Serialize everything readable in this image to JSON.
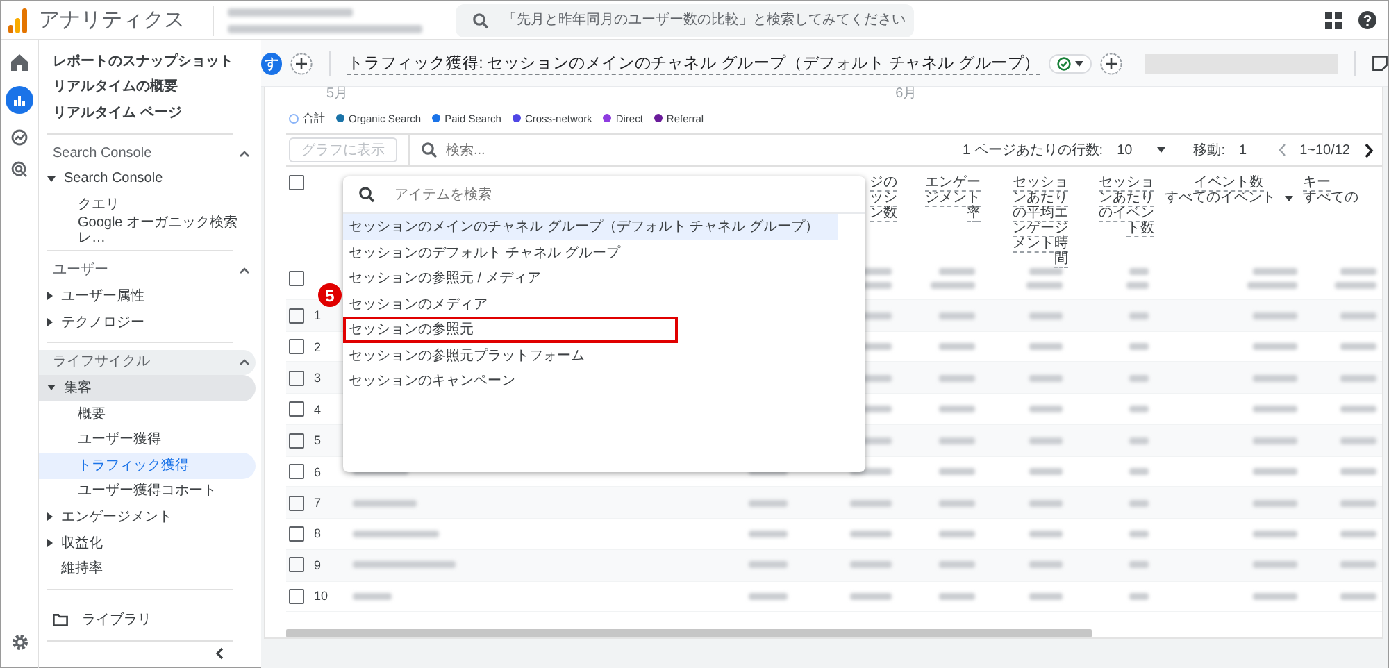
{
  "app": {
    "title": "アナリティクス"
  },
  "search": {
    "placeholder": "「先月と昨年同月のユーザー数の比較」と検索してみてください"
  },
  "sidebar": {
    "top_items": [
      {
        "label": "レポートのスナップショット",
        "selected": false
      },
      {
        "label": "リアルタイムの概要",
        "selected": false
      },
      {
        "label": "リアルタイム ページ",
        "selected": false
      }
    ],
    "sections": [
      {
        "title": "Search Console",
        "expanded": true,
        "items": [
          {
            "label": "Search Console",
            "expanded": true,
            "children": [
              {
                "label": "クエリ",
                "selected": false
              },
              {
                "label": "Google オーガニック検索レ…",
                "selected": false
              }
            ]
          }
        ]
      },
      {
        "title": "ユーザー",
        "expanded": true,
        "items": [
          {
            "label": "ユーザー属性",
            "expanded": false
          },
          {
            "label": "テクノロジー",
            "expanded": false
          }
        ]
      },
      {
        "title": "ライフサイクル",
        "expanded": true,
        "items": [
          {
            "label": "集客",
            "expanded": true,
            "children": [
              {
                "label": "概要",
                "selected": false
              },
              {
                "label": "ユーザー獲得",
                "selected": false
              },
              {
                "label": "トラフィック獲得",
                "selected": true
              },
              {
                "label": "ユーザー獲得コホート",
                "selected": false
              }
            ]
          },
          {
            "label": "エンゲージメント",
            "expanded": false
          },
          {
            "label": "収益化",
            "expanded": false
          },
          {
            "label": "維持率",
            "selected": false
          }
        ]
      }
    ],
    "library": {
      "label": "ライブラリ"
    }
  },
  "report": {
    "avatar": "す",
    "title": "トラフィック獲得: セッションのメインのチャネル グループ（デフォルト チャネル グループ）"
  },
  "chart": {
    "axis_labels": [
      "5月",
      "6月"
    ],
    "legend": [
      {
        "label": "合計",
        "color": "#8ab4f8",
        "kind": "ring"
      },
      {
        "label": "Organic Search",
        "color": "#1a73a8",
        "kind": "dot"
      },
      {
        "label": "Paid Search",
        "color": "#1a73e8",
        "kind": "dot"
      },
      {
        "label": "Cross-network",
        "color": "#4f46e5",
        "kind": "dot"
      },
      {
        "label": "Direct",
        "color": "#8e3ce0",
        "kind": "dot"
      },
      {
        "label": "Referral",
        "color": "#6a1b9a",
        "kind": "dot"
      }
    ]
  },
  "toolbar": {
    "chart_button": "グラフに表示",
    "search_placeholder": "検索...",
    "rows_label": "1 ページあたりの行数:",
    "rows_value": "10",
    "goto_label": "移動:",
    "goto_value": "1",
    "range": "1~10/12"
  },
  "table": {
    "columns": [
      {
        "label": "ジのッシン数"
      },
      {
        "label": "エンゲージメント率"
      },
      {
        "label": "セッションあたりの平均エンゲージメント時間"
      },
      {
        "label": "セッションあたりのイベント数"
      },
      {
        "label": "イベント数",
        "filter": "すべてのイベント"
      },
      {
        "label": "キー",
        "filter": "すべての"
      }
    ],
    "select_all_checked": false,
    "total_checked": false,
    "rows": [
      {
        "index": "1",
        "checked": false
      },
      {
        "index": "2",
        "checked": false
      },
      {
        "index": "3",
        "checked": false
      },
      {
        "index": "4",
        "checked": false
      },
      {
        "index": "5",
        "checked": false
      },
      {
        "index": "6",
        "checked": false
      },
      {
        "index": "7",
        "checked": false
      },
      {
        "index": "8",
        "checked": false
      },
      {
        "index": "9",
        "checked": false
      },
      {
        "index": "10",
        "checked": false
      }
    ]
  },
  "dropdown": {
    "placeholder": "アイテムを検索",
    "items": [
      {
        "label": "セッションのメインのチャネル グループ（デフォルト チャネル グループ）",
        "selected": true
      },
      {
        "label": "セッションのデフォルト チャネル グループ",
        "selected": false
      },
      {
        "label": "セッションの参照元 / メディア",
        "selected": false
      },
      {
        "label": "セッションのメディア",
        "selected": false
      },
      {
        "label": "セッションの参照元",
        "selected": false,
        "callout": "5"
      },
      {
        "label": "セッションの参照元プラットフォーム",
        "selected": false
      },
      {
        "label": "セッションのキャンペーン",
        "selected": false
      }
    ]
  }
}
